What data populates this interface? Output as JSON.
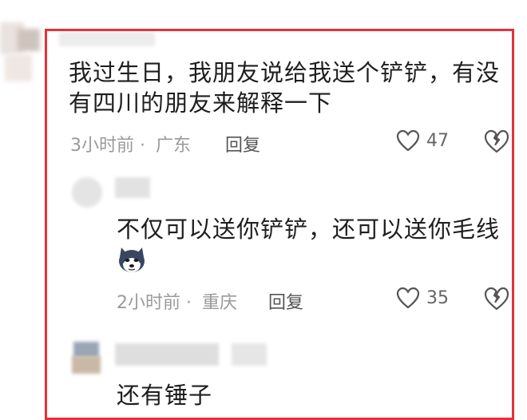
{
  "comment": {
    "text": "我过生日，我朋友说给我送个铲铲，有没有四川的朋友来解释一下",
    "time": "3小时前",
    "separator": "·",
    "region": "广东",
    "reply_label": "回复",
    "likes": "47"
  },
  "reply1": {
    "text": "不仅可以送你铲铲，还可以送你毛线",
    "emoji": "husky-emoji",
    "time": "2小时前",
    "separator": "·",
    "region": "重庆",
    "reply_label": "回复",
    "likes": "35"
  },
  "reply2": {
    "text": "还有锤子"
  },
  "colors": {
    "frame": "#e8303a",
    "meta": "#9a9a9a"
  }
}
